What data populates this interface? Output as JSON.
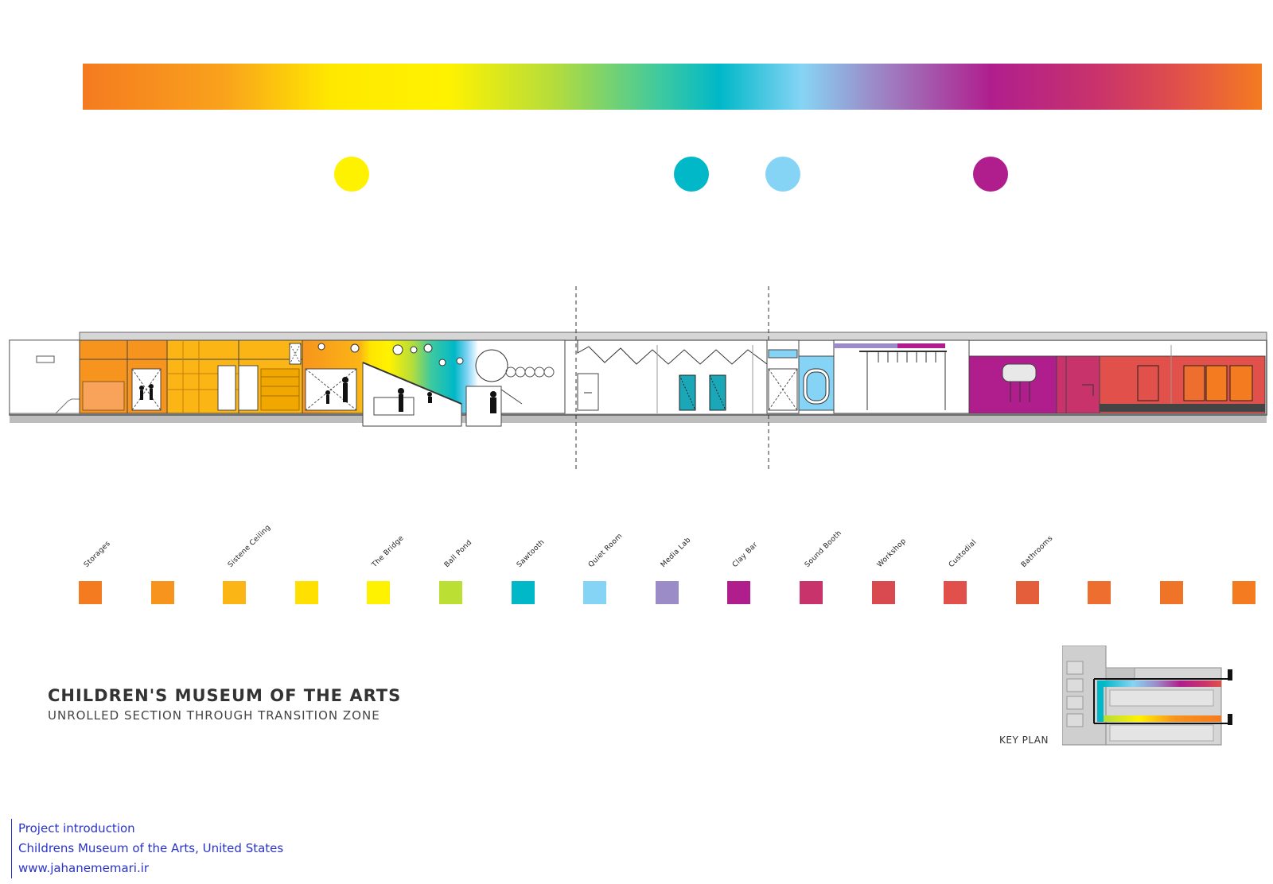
{
  "title": "CHILDREN'S MUSEUM OF THE ARTS",
  "subtitle": "UNROLLED SECTION THROUGH TRANSITION ZONE",
  "key_plan_label": "KEY PLAN",
  "spectrum_colors": [
    "#f47b20",
    "#f9a21c",
    "#ffe800",
    "#fff200",
    "#b4dc3c",
    "#3ec9a0",
    "#00b8c8",
    "#86d4f5",
    "#9b8cc8",
    "#b01e8e",
    "#c8336b",
    "#e1504a",
    "#f47b20"
  ],
  "highlight_dots": [
    {
      "color": "#fff200"
    },
    {
      "color": "#00b8c8"
    },
    {
      "color": "#86d4f5"
    },
    {
      "color": "#b01e8e"
    }
  ],
  "rooms": [
    {
      "label": "Storages",
      "color": "#f47b20"
    },
    {
      "label": "",
      "color": "#f7941d"
    },
    {
      "label": "Sistene Ceiling",
      "color": "#fbb515"
    },
    {
      "label": "",
      "color": "#ffe000"
    },
    {
      "label": "The Bridge",
      "color": "#fff200"
    },
    {
      "label": "Ball Pond",
      "color": "#bbe033"
    },
    {
      "label": "Sawtooth",
      "color": "#00b8c8"
    },
    {
      "label": "Quiet Room",
      "color": "#86d4f5"
    },
    {
      "label": "Media Lab",
      "color": "#9b8cc8"
    },
    {
      "label": "Clay Bar",
      "color": "#b01e8e"
    },
    {
      "label": "Sound Booth",
      "color": "#c8336b"
    },
    {
      "label": "Workshop",
      "color": "#d94a50"
    },
    {
      "label": "Custodial",
      "color": "#e1504a"
    },
    {
      "label": "Bathrooms",
      "color": "#e55e3c"
    },
    {
      "label": "",
      "color": "#ee6e30"
    },
    {
      "label": "",
      "color": "#f07428"
    },
    {
      "label": "",
      "color": "#f47b20"
    }
  ],
  "credits": [
    "Project introduction",
    "Childrens Museum of the Arts, United States",
    "www.jahanememari.ir"
  ]
}
